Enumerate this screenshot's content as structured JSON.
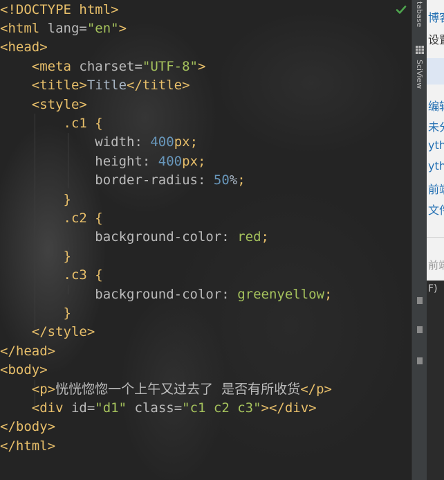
{
  "editor": {
    "lines": [
      [
        {
          "t": "<!DOCTYPE html>",
          "c": "tag"
        }
      ],
      [
        {
          "t": "<html ",
          "c": "tag"
        },
        {
          "t": "lang=",
          "c": "attr"
        },
        {
          "t": "\"en\"",
          "c": "str"
        },
        {
          "t": ">",
          "c": "tag"
        }
      ],
      [
        {
          "t": "<head>",
          "c": "tag"
        }
      ],
      [
        {
          "t": "    "
        },
        {
          "t": "<meta ",
          "c": "tag"
        },
        {
          "t": "charset=",
          "c": "attr"
        },
        {
          "t": "\"UTF-8\"",
          "c": "str"
        },
        {
          "t": ">",
          "c": "tag"
        }
      ],
      [
        {
          "t": "    "
        },
        {
          "t": "<title>",
          "c": "tag"
        },
        {
          "t": "Title",
          "c": "plain"
        },
        {
          "t": "</title>",
          "c": "tag"
        }
      ],
      [
        {
          "t": "    "
        },
        {
          "t": "<style>",
          "c": "tag"
        }
      ],
      [
        {
          "t": "        "
        },
        {
          "t": ".c1 {",
          "c": "sel"
        }
      ],
      [
        {
          "t": "            "
        },
        {
          "t": "width: ",
          "c": "prop"
        },
        {
          "t": "400",
          "c": "num"
        },
        {
          "t": "px",
          "c": "tag"
        },
        {
          "t": ";",
          "c": "tag"
        }
      ],
      [
        {
          "t": "            "
        },
        {
          "t": "height: ",
          "c": "prop"
        },
        {
          "t": "400",
          "c": "num"
        },
        {
          "t": "px",
          "c": "tag"
        },
        {
          "t": ";",
          "c": "tag"
        }
      ],
      [
        {
          "t": "            "
        },
        {
          "t": "border-radius: ",
          "c": "prop"
        },
        {
          "t": "50",
          "c": "num"
        },
        {
          "t": "%",
          "c": "plain"
        },
        {
          "t": ";",
          "c": "tag"
        }
      ],
      [
        {
          "t": "        "
        },
        {
          "t": "}",
          "c": "sel"
        }
      ],
      [
        {
          "t": "        "
        },
        {
          "t": ".c2 {",
          "c": "sel"
        }
      ],
      [
        {
          "t": "            "
        },
        {
          "t": "background-color: ",
          "c": "prop"
        },
        {
          "t": "red",
          "c": "str"
        },
        {
          "t": ";",
          "c": "tag"
        }
      ],
      [
        {
          "t": "        "
        },
        {
          "t": "}",
          "c": "sel"
        }
      ],
      [
        {
          "t": "        "
        },
        {
          "t": ".c3 {",
          "c": "sel"
        }
      ],
      [
        {
          "t": "            "
        },
        {
          "t": "background-color: ",
          "c": "prop"
        },
        {
          "t": "greenyellow",
          "c": "str"
        },
        {
          "t": ";",
          "c": "tag"
        }
      ],
      [
        {
          "t": "        "
        },
        {
          "t": "}",
          "c": "sel"
        }
      ],
      [
        {
          "t": "    "
        },
        {
          "t": "</style>",
          "c": "tag"
        }
      ],
      [
        {
          "t": "</head>",
          "c": "tag"
        }
      ],
      [
        {
          "t": "<body>",
          "c": "tag"
        }
      ],
      [
        {
          "t": "    "
        },
        {
          "t": "<p>",
          "c": "tag"
        },
        {
          "t": "恍恍惚惚一个上午又过去了  是否有所收货",
          "c": "cjk"
        },
        {
          "t": "</p>",
          "c": "tag"
        }
      ],
      [
        {
          "t": "    "
        },
        {
          "t": "<div ",
          "c": "tag"
        },
        {
          "t": "id=",
          "c": "attr"
        },
        {
          "t": "\"d1\" ",
          "c": "str"
        },
        {
          "t": "class=",
          "c": "attr"
        },
        {
          "t": "\"c1 c2 c3\"",
          "c": "str"
        },
        {
          "t": "></div>",
          "c": "tag"
        }
      ],
      [
        {
          "t": "</body>",
          "c": "tag"
        }
      ],
      [
        {
          "t": "</html>",
          "c": "tag"
        }
      ]
    ]
  },
  "colors": {
    "tag": "#e8bf6a",
    "string": "#a5c25c",
    "number": "#6897bb",
    "attr": "#bababa",
    "check": "#4ea44e",
    "link": "#2470b3"
  },
  "status": {
    "icon": "check-icon"
  },
  "right_toolbar": {
    "database_tab": "tabase",
    "sciview_tab": "SciView"
  },
  "right_panel": {
    "items": [
      "博客",
      "设置",
      "编辑",
      "未分",
      "ytho",
      "ytho",
      "前端",
      "文件",
      "前端",
      "F)"
    ]
  }
}
